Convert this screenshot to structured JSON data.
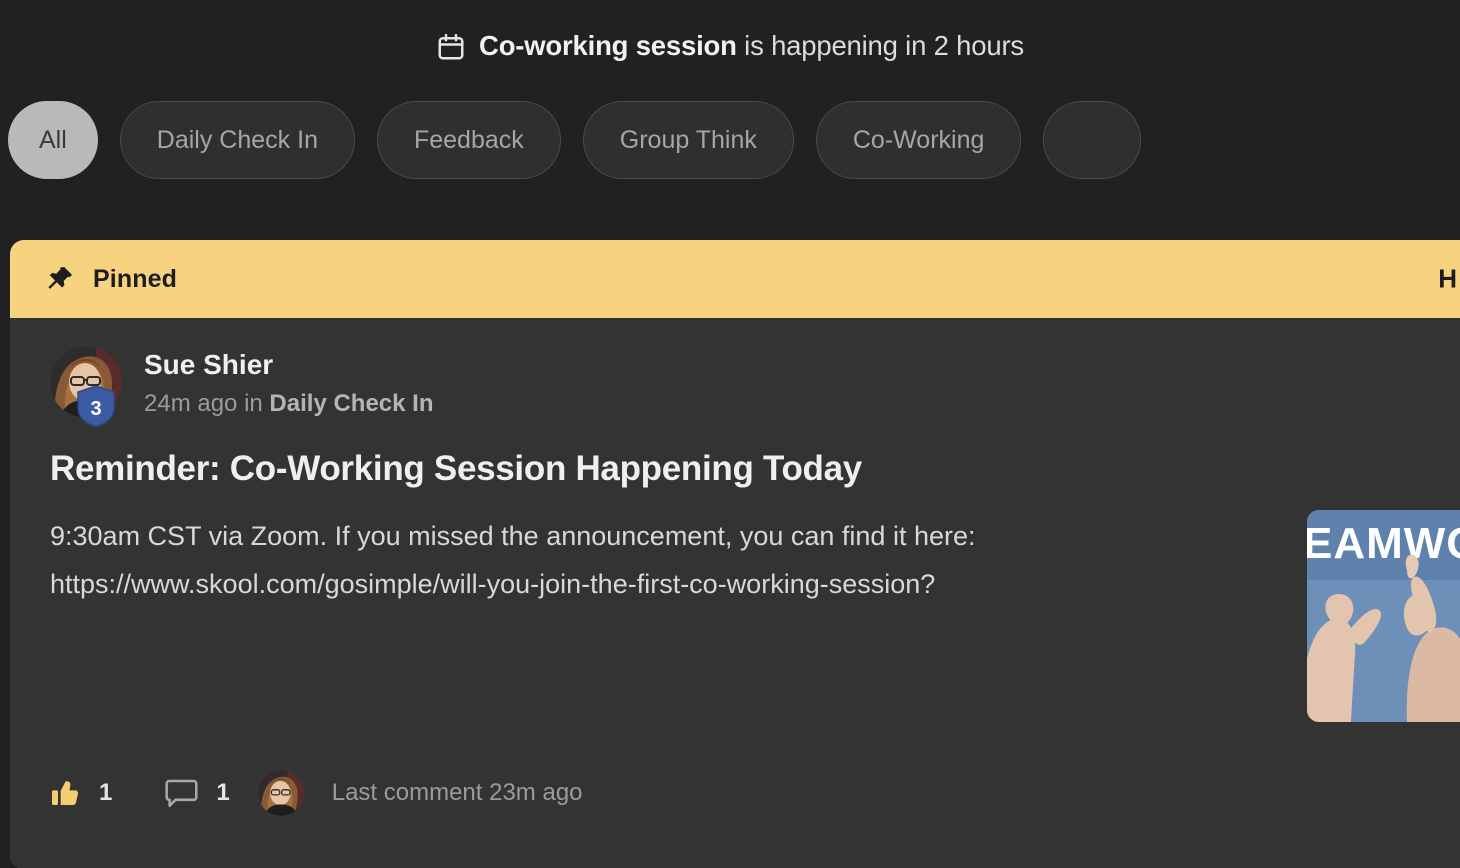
{
  "announcement": {
    "icon": "calendar-icon",
    "event_name": "Co-working session",
    "rest": " is happening in 2 hours"
  },
  "filters": {
    "chips": [
      {
        "label": "All",
        "active": true
      },
      {
        "label": "Daily Check In",
        "active": false
      },
      {
        "label": "Feedback",
        "active": false
      },
      {
        "label": "Group Think",
        "active": false
      },
      {
        "label": "Co-Working",
        "active": false
      },
      {
        "label": "",
        "active": false
      }
    ]
  },
  "post": {
    "pinned_banner": {
      "icon": "pin-icon",
      "label": "Pinned",
      "action_label": "H"
    },
    "author": {
      "name": "Sue Shier",
      "level_badge": "3",
      "avatar": "avatar"
    },
    "meta": {
      "time_ago": "24m ago in ",
      "group": "Daily Check In"
    },
    "title": "Reminder: Co-Working Session Happening Today",
    "body_line1": "9:30am CST via Zoom. If you missed the announcement, you can find it here:",
    "body_line2": "https://www.skool.com/gosimple/will-you-join-the-first-co-working-session?",
    "thumbnail": {
      "alt": "TEAMWORK high five photo",
      "caption": "EAMWO"
    },
    "footer": {
      "like_icon": "thumbs-up-icon",
      "like_count": "1",
      "comment_icon": "comment-bubble-icon",
      "comment_count": "1",
      "last_comment": "Last comment 23m ago"
    }
  },
  "colors": {
    "page_bg": "#212121",
    "card_bg": "#333333",
    "pinned_bg": "#f7d380",
    "chip_active_bg": "#b9b9b9",
    "badge_blue": "#3b5ba5",
    "thumbup_yellow": "#f2cf73"
  }
}
